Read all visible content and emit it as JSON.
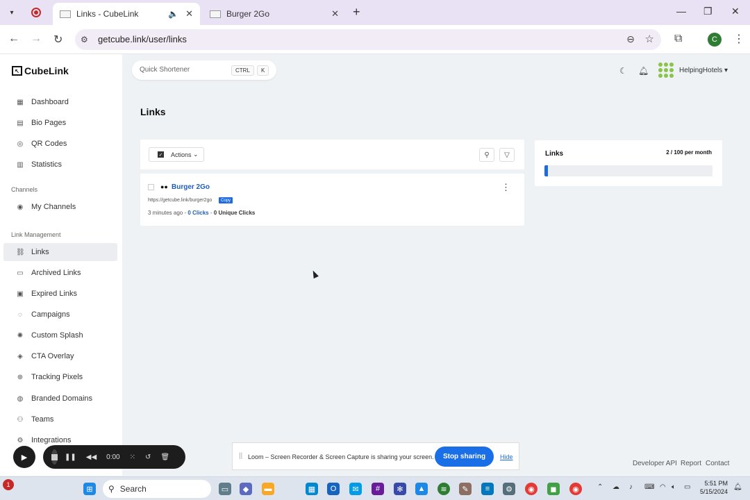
{
  "browser": {
    "tabs": [
      {
        "title": "Links - CubeLink",
        "active": true
      },
      {
        "title": "Burger 2Go",
        "active": false
      }
    ],
    "url": "getcube.link/user/links",
    "profile_initial": "C"
  },
  "brand": {
    "name": "CubeLink",
    "accent": "#1e6ae0"
  },
  "sidebar": {
    "items": [
      {
        "label": "Dashboard",
        "icon": "dashboard-icon"
      },
      {
        "label": "Bio Pages",
        "icon": "book-icon"
      },
      {
        "label": "QR Codes",
        "icon": "qr-icon"
      },
      {
        "label": "Statistics",
        "icon": "chart-icon"
      }
    ],
    "section_channels": "Channels",
    "channels": [
      {
        "label": "My Channels",
        "icon": "channels-icon"
      }
    ],
    "section_links": "Link Management",
    "link_items": [
      {
        "label": "Links",
        "icon": "link-icon",
        "active": true
      },
      {
        "label": "Archived Links",
        "icon": "archive-icon"
      },
      {
        "label": "Expired Links",
        "icon": "calendar-icon"
      },
      {
        "label": "Campaigns",
        "icon": "campaign-icon"
      },
      {
        "label": "Custom Splash",
        "icon": "splash-icon"
      },
      {
        "label": "CTA Overlay",
        "icon": "layers-icon"
      },
      {
        "label": "Tracking Pixels",
        "icon": "pixel-icon"
      },
      {
        "label": "Branded Domains",
        "icon": "globe-icon"
      },
      {
        "label": "Teams",
        "icon": "users-icon"
      },
      {
        "label": "Integrations",
        "icon": "plug-icon"
      }
    ]
  },
  "header": {
    "quick_placeholder": "Quick Shortener",
    "kbd_ctrl": "CTRL",
    "kbd_k": "K",
    "username": "HelpingHotels"
  },
  "main": {
    "title": "Links",
    "actions_label": "Actions",
    "link": {
      "title": "Burger 2Go",
      "short_url": "https://getcube.link/burger2go",
      "copy_label": "Copy",
      "age": "3 minutes ago",
      "clicks": "0 Clicks",
      "unique_clicks": "0 Unique Clicks"
    },
    "usage": {
      "title": "Links",
      "count": "2 / 100 per month",
      "fraction": 0.02
    }
  },
  "footer": {
    "api": "Developer API",
    "report": "Report",
    "contact": "Contact"
  },
  "share_bar": {
    "message": "Loom – Screen Recorder & Screen Capture is sharing your screen.",
    "stop": "Stop sharing",
    "hide": "Hide"
  },
  "recorder": {
    "time": "0:00"
  },
  "taskbar": {
    "search": "Search",
    "time": "5:51 PM",
    "date": "5/15/2024",
    "badge": "1"
  }
}
